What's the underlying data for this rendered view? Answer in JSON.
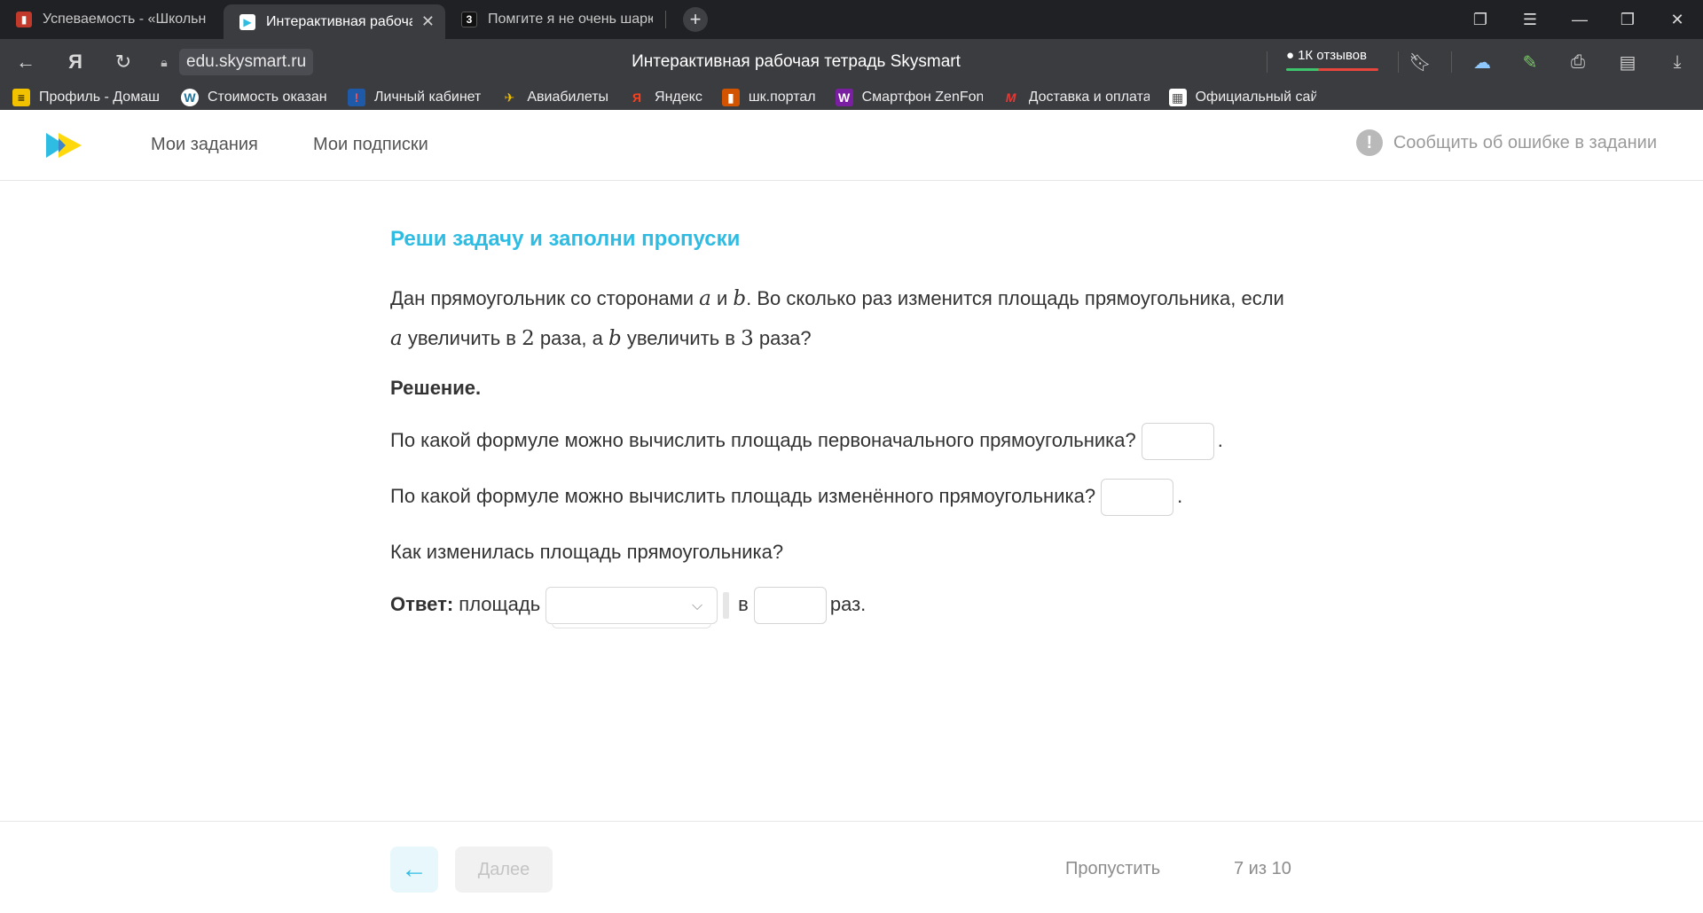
{
  "browser": {
    "tabs": [
      {
        "label": "Успеваемость - «Школьн",
        "favicon_color": "#c0392b",
        "favicon_glyph": "▮"
      },
      {
        "label": "Интерактивная рабоча",
        "favicon_color": "#ffffff",
        "favicon_glyph": "▶",
        "active": true
      },
      {
        "label": "Помгите я не очень шарю",
        "favicon_color": "#111111",
        "favicon_glyph": "3"
      }
    ],
    "tab_close_glyph": "✕",
    "new_tab_glyph": "+",
    "url": "edu.skysmart.ru",
    "page_title": "Интерактивная рабочая тетрадь Skysmart",
    "reviews_label": "1К отзывов",
    "bookmarks": [
      {
        "label": "Профиль - Домаш",
        "icon_color": "#f2c200",
        "glyph": "≡"
      },
      {
        "label": "Стоимость оказан",
        "icon_color": "#ffffff",
        "glyph": "W"
      },
      {
        "label": "Личный кабинет",
        "icon_color": "#1e5aa8",
        "glyph": "!"
      },
      {
        "label": "Авиабилеты",
        "icon_color": "#f0c000",
        "glyph": "✈"
      },
      {
        "label": "Яндекс",
        "icon_color": "#fc3f1d",
        "glyph": "Я"
      },
      {
        "label": "шк.портал",
        "icon_color": "#d35400",
        "glyph": "▮"
      },
      {
        "label": "Смартфон ZenFon",
        "icon_color": "#7b1fa2",
        "glyph": "W"
      },
      {
        "label": "Доставка и оплата",
        "icon_color": "#e53935",
        "glyph": "M"
      },
      {
        "label": "Официальный сай",
        "icon_color": "#ffffff",
        "glyph": "▦"
      }
    ]
  },
  "site": {
    "nav": [
      "Мои задания",
      "Мои подписки"
    ],
    "report_label": "Сообщить об ошибке в задании",
    "report_icon_glyph": "!",
    "brand_colors": {
      "primary": "#2fbce3",
      "accent": "#ffd600"
    }
  },
  "task": {
    "title": "Реши задачу и заполни пропуски",
    "problem": {
      "part1": "Дан прямоугольник со сторонами ",
      "var_a": "a",
      "and": " и ",
      "var_b": "b",
      "part2": ". Во сколько раз изменится площадь прямоугольника, если",
      "line2_var_a": "a",
      "line2_part1": " увеличить в ",
      "num2": "2",
      "line2_part2": " раза, а ",
      "line2_var_b": "b",
      "line2_part3": " увеличить в ",
      "num3": "3",
      "line2_part4": " раза?"
    },
    "solution_label": "Решение.",
    "q1": "По какой формуле можно вычислить площадь первоначального прямоугольника?",
    "q2": "По какой формуле можно вычислить площадь изменённого прямоугольника?",
    "q3": "Как изменилась площадь прямоугольника?",
    "period": ".",
    "answer_label": "Ответ:",
    "answer_word": " площадь",
    "answer_in": "в",
    "answer_times": "раз.",
    "q1_value": "",
    "q2_value": "",
    "select_value": "",
    "times_value": ""
  },
  "footer": {
    "back_glyph": "←",
    "next_label": "Далее",
    "skip_label": "Пропустить",
    "progress": "7 из 10"
  }
}
